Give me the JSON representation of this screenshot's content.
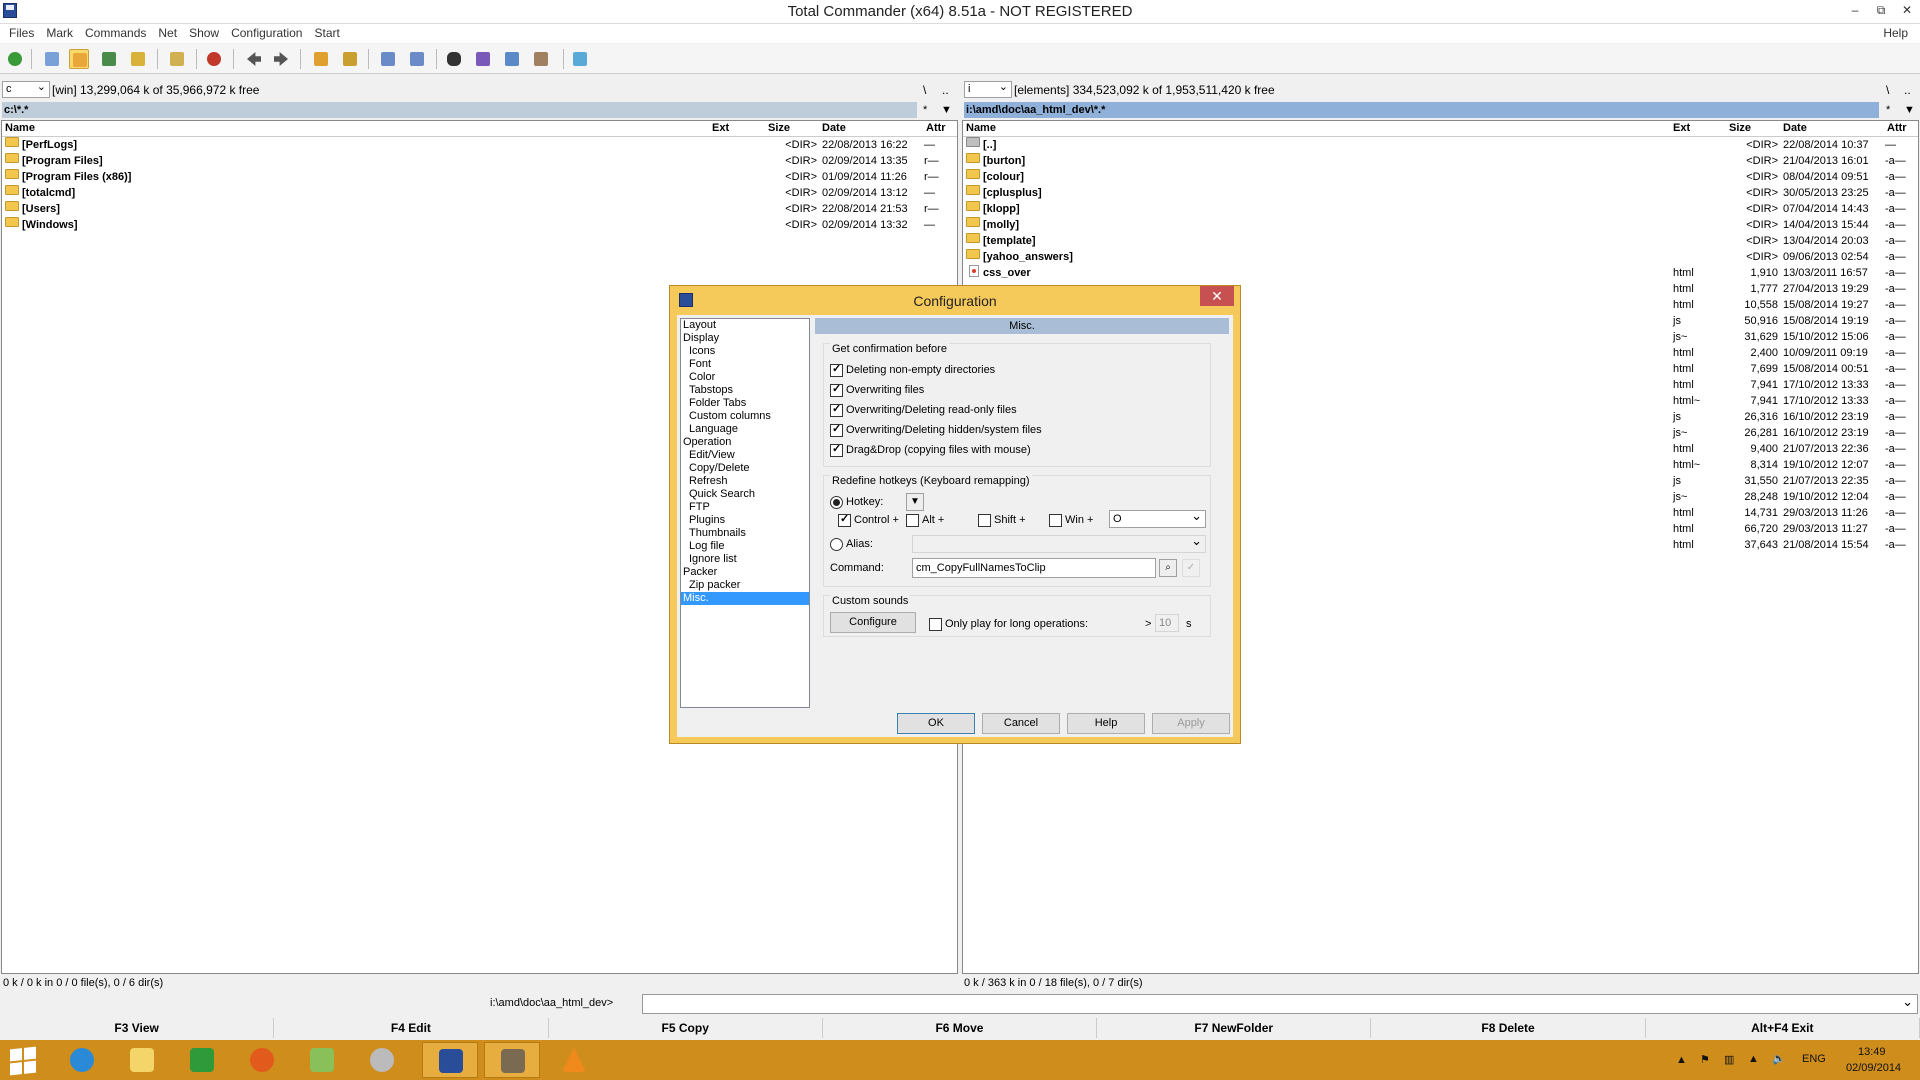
{
  "window": {
    "title": "Total Commander (x64) 8.51a - NOT REGISTERED",
    "minimize": "–",
    "restore": "⧉",
    "close": "✕"
  },
  "menu": {
    "items": [
      "Files",
      "Mark",
      "Commands",
      "Net",
      "Show",
      "Configuration",
      "Start"
    ],
    "help": "Help"
  },
  "left": {
    "drive": "c",
    "drive_info": "[win]  13,299,064 k of 35,966,972 k free",
    "root_btn": "\\",
    "up_btn": "..",
    "path": "c:\\*.*",
    "path_star": "*",
    "path_arrow": "▼",
    "columns": {
      "name": "Name",
      "ext": "Ext",
      "size": "Size",
      "date": "Date",
      "attr": "Attr"
    },
    "rows": [
      {
        "name": "[PerfLogs]",
        "ext": "",
        "size": "<DIR>",
        "date": "22/08/2013 16:22",
        "attr": "—"
      },
      {
        "name": "[Program Files]",
        "ext": "",
        "size": "<DIR>",
        "date": "02/09/2014 13:35",
        "attr": "r—"
      },
      {
        "name": "[Program Files (x86)]",
        "ext": "",
        "size": "<DIR>",
        "date": "01/09/2014 11:26",
        "attr": "r—"
      },
      {
        "name": "[totalcmd]",
        "ext": "",
        "size": "<DIR>",
        "date": "02/09/2014 13:12",
        "attr": "—"
      },
      {
        "name": "[Users]",
        "ext": "",
        "size": "<DIR>",
        "date": "22/08/2014 21:53",
        "attr": "r—"
      },
      {
        "name": "[Windows]",
        "ext": "",
        "size": "<DIR>",
        "date": "02/09/2014 13:32",
        "attr": "—"
      }
    ],
    "status": "0 k / 0 k in 0 / 0 file(s), 0 / 6 dir(s)"
  },
  "right": {
    "drive": "i",
    "drive_info": "[elements]  334,523,092 k of 1,953,511,420 k free",
    "root_btn": "\\",
    "up_btn": "..",
    "path": "i:\\amd\\doc\\aa_html_dev\\*.*",
    "path_star": "*",
    "path_arrow": "▼",
    "columns": {
      "name": "Name",
      "ext": "Ext",
      "size": "Size",
      "date": "Date",
      "attr": "Attr"
    },
    "rows": [
      {
        "name": "[..]",
        "kind": "up",
        "ext": "",
        "size": "<DIR>",
        "date": "22/08/2014 10:37",
        "attr": "—"
      },
      {
        "name": "[burton]",
        "kind": "dir",
        "ext": "",
        "size": "<DIR>",
        "date": "21/04/2013 16:01",
        "attr": "-a—"
      },
      {
        "name": "[colour]",
        "kind": "dir",
        "ext": "",
        "size": "<DIR>",
        "date": "08/04/2014 09:51",
        "attr": "-a—"
      },
      {
        "name": "[cplusplus]",
        "kind": "dir",
        "ext": "",
        "size": "<DIR>",
        "date": "30/05/2013 23:25",
        "attr": "-a—"
      },
      {
        "name": "[klopp]",
        "kind": "dir",
        "ext": "",
        "size": "<DIR>",
        "date": "07/04/2014 14:43",
        "attr": "-a—"
      },
      {
        "name": "[molly]",
        "kind": "dir",
        "ext": "",
        "size": "<DIR>",
        "date": "14/04/2013 15:44",
        "attr": "-a—"
      },
      {
        "name": "[template]",
        "kind": "dir",
        "ext": "",
        "size": "<DIR>",
        "date": "13/04/2014 20:03",
        "attr": "-a—"
      },
      {
        "name": "[yahoo_answers]",
        "kind": "dir",
        "ext": "",
        "size": "<DIR>",
        "date": "09/06/2013 02:54",
        "attr": "-a—"
      },
      {
        "name": "css_over",
        "kind": "file",
        "ext": "html",
        "size": "1,910",
        "date": "13/03/2011 16:57",
        "attr": "-a—"
      },
      {
        "name": "",
        "kind": "none",
        "ext": "html",
        "size": "1,777",
        "date": "27/04/2013 19:29",
        "attr": "-a—"
      },
      {
        "name": "",
        "kind": "none",
        "ext": "html",
        "size": "10,558",
        "date": "15/08/2014 19:27",
        "attr": "-a—"
      },
      {
        "name": "",
        "kind": "none",
        "ext": "js",
        "size": "50,916",
        "date": "15/08/2014 19:19",
        "attr": "-a—"
      },
      {
        "name": "",
        "kind": "none",
        "ext": "js~",
        "size": "31,629",
        "date": "15/10/2012 15:06",
        "attr": "-a—"
      },
      {
        "name": "",
        "kind": "none",
        "ext": "html",
        "size": "2,400",
        "date": "10/09/2011 09:19",
        "attr": "-a—"
      },
      {
        "name": "",
        "kind": "none",
        "ext": "html",
        "size": "7,699",
        "date": "15/08/2014 00:51",
        "attr": "-a—"
      },
      {
        "name": "",
        "kind": "none",
        "ext": "html",
        "size": "7,941",
        "date": "17/10/2012 13:33",
        "attr": "-a—"
      },
      {
        "name": "",
        "kind": "none",
        "ext": "html~",
        "size": "7,941",
        "date": "17/10/2012 13:33",
        "attr": "-a—"
      },
      {
        "name": "",
        "kind": "none",
        "ext": "js",
        "size": "26,316",
        "date": "16/10/2012 23:19",
        "attr": "-a—"
      },
      {
        "name": "",
        "kind": "none",
        "ext": "js~",
        "size": "26,281",
        "date": "16/10/2012 23:19",
        "attr": "-a—"
      },
      {
        "name": "",
        "kind": "none",
        "ext": "html",
        "size": "9,400",
        "date": "21/07/2013 22:36",
        "attr": "-a—"
      },
      {
        "name": "",
        "kind": "none",
        "ext": "html~",
        "size": "8,314",
        "date": "19/10/2012 12:07",
        "attr": "-a—"
      },
      {
        "name": "",
        "kind": "none",
        "ext": "js",
        "size": "31,550",
        "date": "21/07/2013 22:35",
        "attr": "-a—"
      },
      {
        "name": "",
        "kind": "none",
        "ext": "js~",
        "size": "28,248",
        "date": "19/10/2012 12:04",
        "attr": "-a—"
      },
      {
        "name": "",
        "kind": "none",
        "ext": "html",
        "size": "14,731",
        "date": "29/03/2013 11:26",
        "attr": "-a—"
      },
      {
        "name": "",
        "kind": "none",
        "ext": "html",
        "size": "66,720",
        "date": "29/03/2013 11:27",
        "attr": "-a—"
      },
      {
        "name": "",
        "kind": "none",
        "ext": "html",
        "size": "37,643",
        "date": "21/08/2014 15:54",
        "attr": "-a—"
      }
    ],
    "status": "0 k / 363 k in 0 / 18 file(s), 0 / 7 dir(s)"
  },
  "command_line": {
    "label": "i:\\amd\\doc\\aa_html_dev>",
    "value": ""
  },
  "function_keys": [
    "F3 View",
    "F4 Edit",
    "F5 Copy",
    "F6 Move",
    "F7 NewFolder",
    "F8 Delete",
    "Alt+F4 Exit"
  ],
  "dialog": {
    "title": "Configuration",
    "close": "✕",
    "tree": [
      {
        "label": "Layout",
        "level": 0
      },
      {
        "label": "Display",
        "level": 0
      },
      {
        "label": "Icons",
        "level": 1
      },
      {
        "label": "Font",
        "level": 1
      },
      {
        "label": "Color",
        "level": 1
      },
      {
        "label": "Tabstops",
        "level": 1
      },
      {
        "label": "Folder Tabs",
        "level": 1
      },
      {
        "label": "Custom columns",
        "level": 1
      },
      {
        "label": "Language",
        "level": 1
      },
      {
        "label": "Operation",
        "level": 0
      },
      {
        "label": "Edit/View",
        "level": 1
      },
      {
        "label": "Copy/Delete",
        "level": 1
      },
      {
        "label": "Refresh",
        "level": 1
      },
      {
        "label": "Quick Search",
        "level": 1
      },
      {
        "label": "FTP",
        "level": 1
      },
      {
        "label": "Plugins",
        "level": 1
      },
      {
        "label": "Thumbnails",
        "level": 1
      },
      {
        "label": "Log file",
        "level": 1
      },
      {
        "label": "Ignore list",
        "level": 1
      },
      {
        "label": "Packer",
        "level": 0
      },
      {
        "label": "Zip packer",
        "level": 1
      },
      {
        "label": "Misc.",
        "level": 0,
        "selected": true
      }
    ],
    "section_title": "Misc.",
    "confirm_group": "Get confirmation before",
    "confirm": [
      {
        "label": "Deleting non-empty directories",
        "checked": true
      },
      {
        "label": "Overwriting files",
        "checked": true
      },
      {
        "label": "Overwriting/Deleting read-only files",
        "checked": true
      },
      {
        "label": "Overwriting/Deleting hidden/system files",
        "checked": true
      },
      {
        "label": "Drag&Drop (copying files with mouse)",
        "checked": true
      }
    ],
    "hotkey_group": "Redefine hotkeys (Keyboard remapping)",
    "hotkey_label": "Hotkey:",
    "hotkey_dropdown": "▼",
    "modifiers": {
      "control": "Control +",
      "alt": "Alt +",
      "shift": "Shift +",
      "win": "Win +"
    },
    "key_value": "O",
    "alias_label": "Alias:",
    "alias_value": "",
    "command_label": "Command:",
    "command_value": "cm_CopyFullNamesToClip",
    "sounds_group": "Custom sounds",
    "configure_btn": "Configure",
    "long_ops_label": "Only play for long operations:",
    "gt": ">",
    "seconds_value": "10",
    "seconds_unit": "s",
    "buttons": {
      "ok": "OK",
      "cancel": "Cancel",
      "help": "Help",
      "apply": "Apply"
    }
  },
  "taskbar": {
    "lang": "ENG",
    "time": "13:49",
    "date": "02/09/2014"
  },
  "colors": {
    "accent": "#f5c95a",
    "selection": "#3399ff",
    "taskbar": "#cf8d1c",
    "active_path": "#8fb0d8"
  }
}
